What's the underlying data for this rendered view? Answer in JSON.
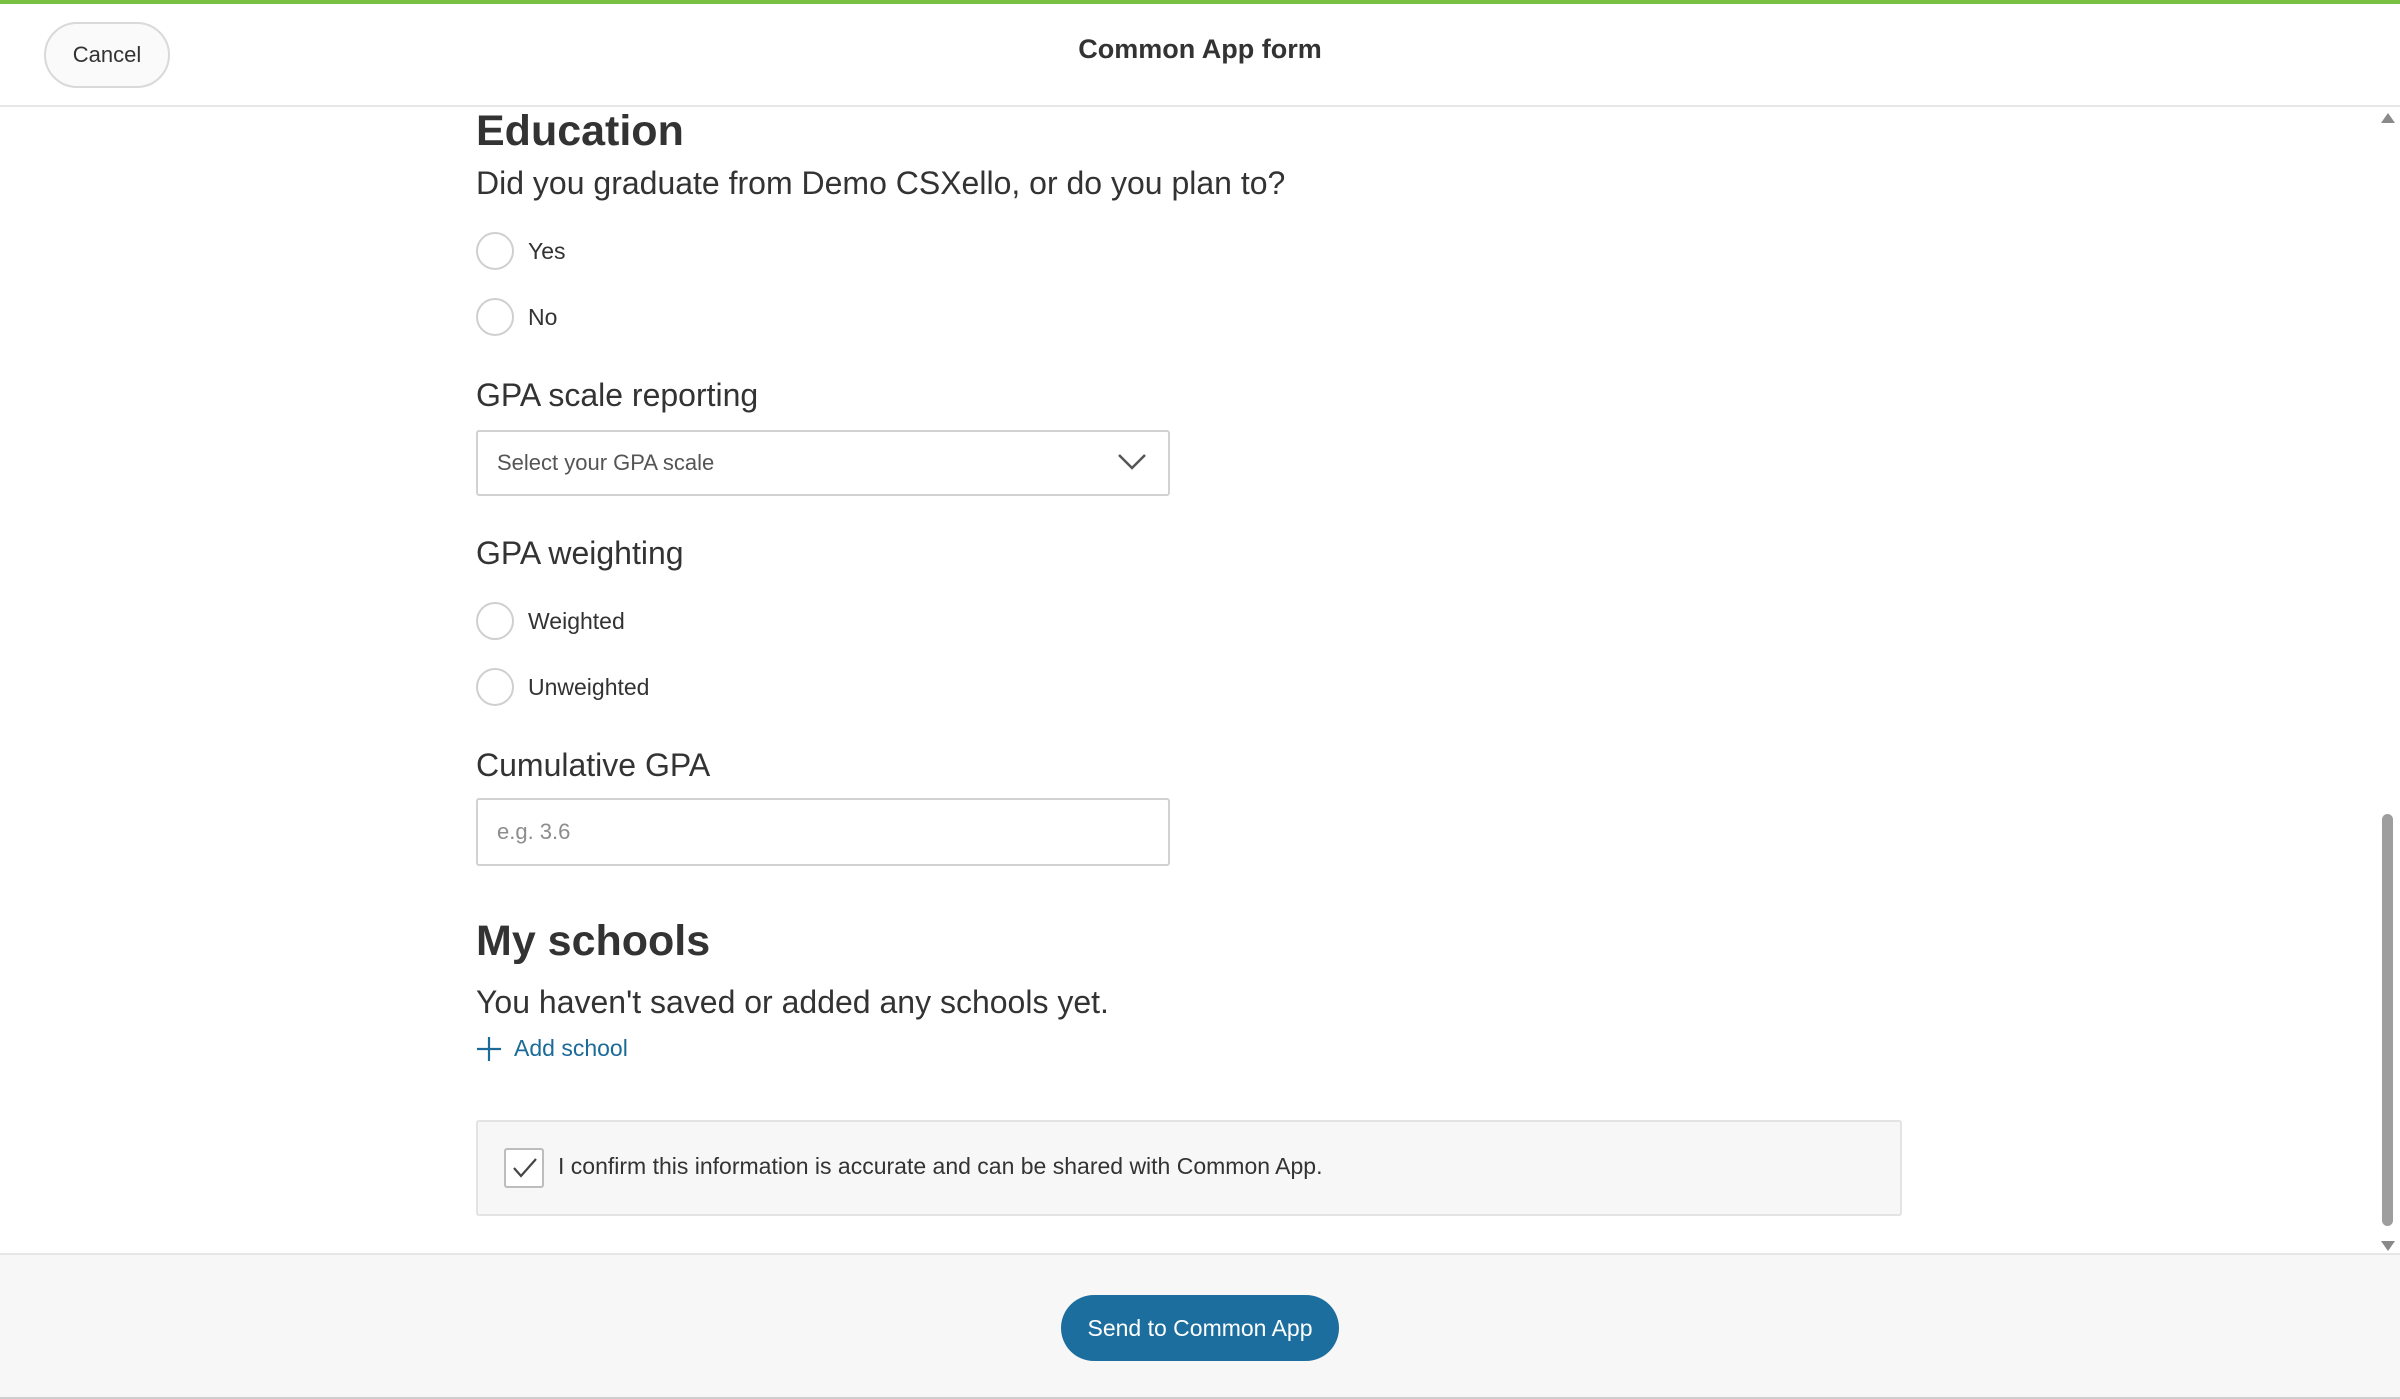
{
  "header": {
    "cancel_label": "Cancel",
    "title": "Common App form"
  },
  "colors": {
    "accent_progress": "#7ac143",
    "primary_button": "#1c6e9e",
    "link": "#1b6a9a"
  },
  "education": {
    "heading": "Education",
    "graduate_question": "Did you graduate from Demo CSXello, or do you plan to?",
    "graduate_options": [
      "Yes",
      "No"
    ],
    "gpa_scale_label": "GPA scale reporting",
    "gpa_scale_placeholder": "Select your GPA scale",
    "gpa_weighting_label": "GPA weighting",
    "gpa_weighting_options": [
      "Weighted",
      "Unweighted"
    ],
    "cumulative_gpa_label": "Cumulative GPA",
    "cumulative_gpa_placeholder": "e.g. 3.6",
    "cumulative_gpa_value": ""
  },
  "schools": {
    "heading": "My schools",
    "empty_message": "You haven't saved or added any schools yet.",
    "add_label": "Add school"
  },
  "confirmation": {
    "label": "I confirm this information is accurate and can be shared with Common App.",
    "checked": true
  },
  "footer": {
    "send_label": "Send to Common App"
  },
  "icons": {
    "dropdown": "chevron-down-icon",
    "add": "plus-icon",
    "checkbox": "checkmark-icon"
  }
}
